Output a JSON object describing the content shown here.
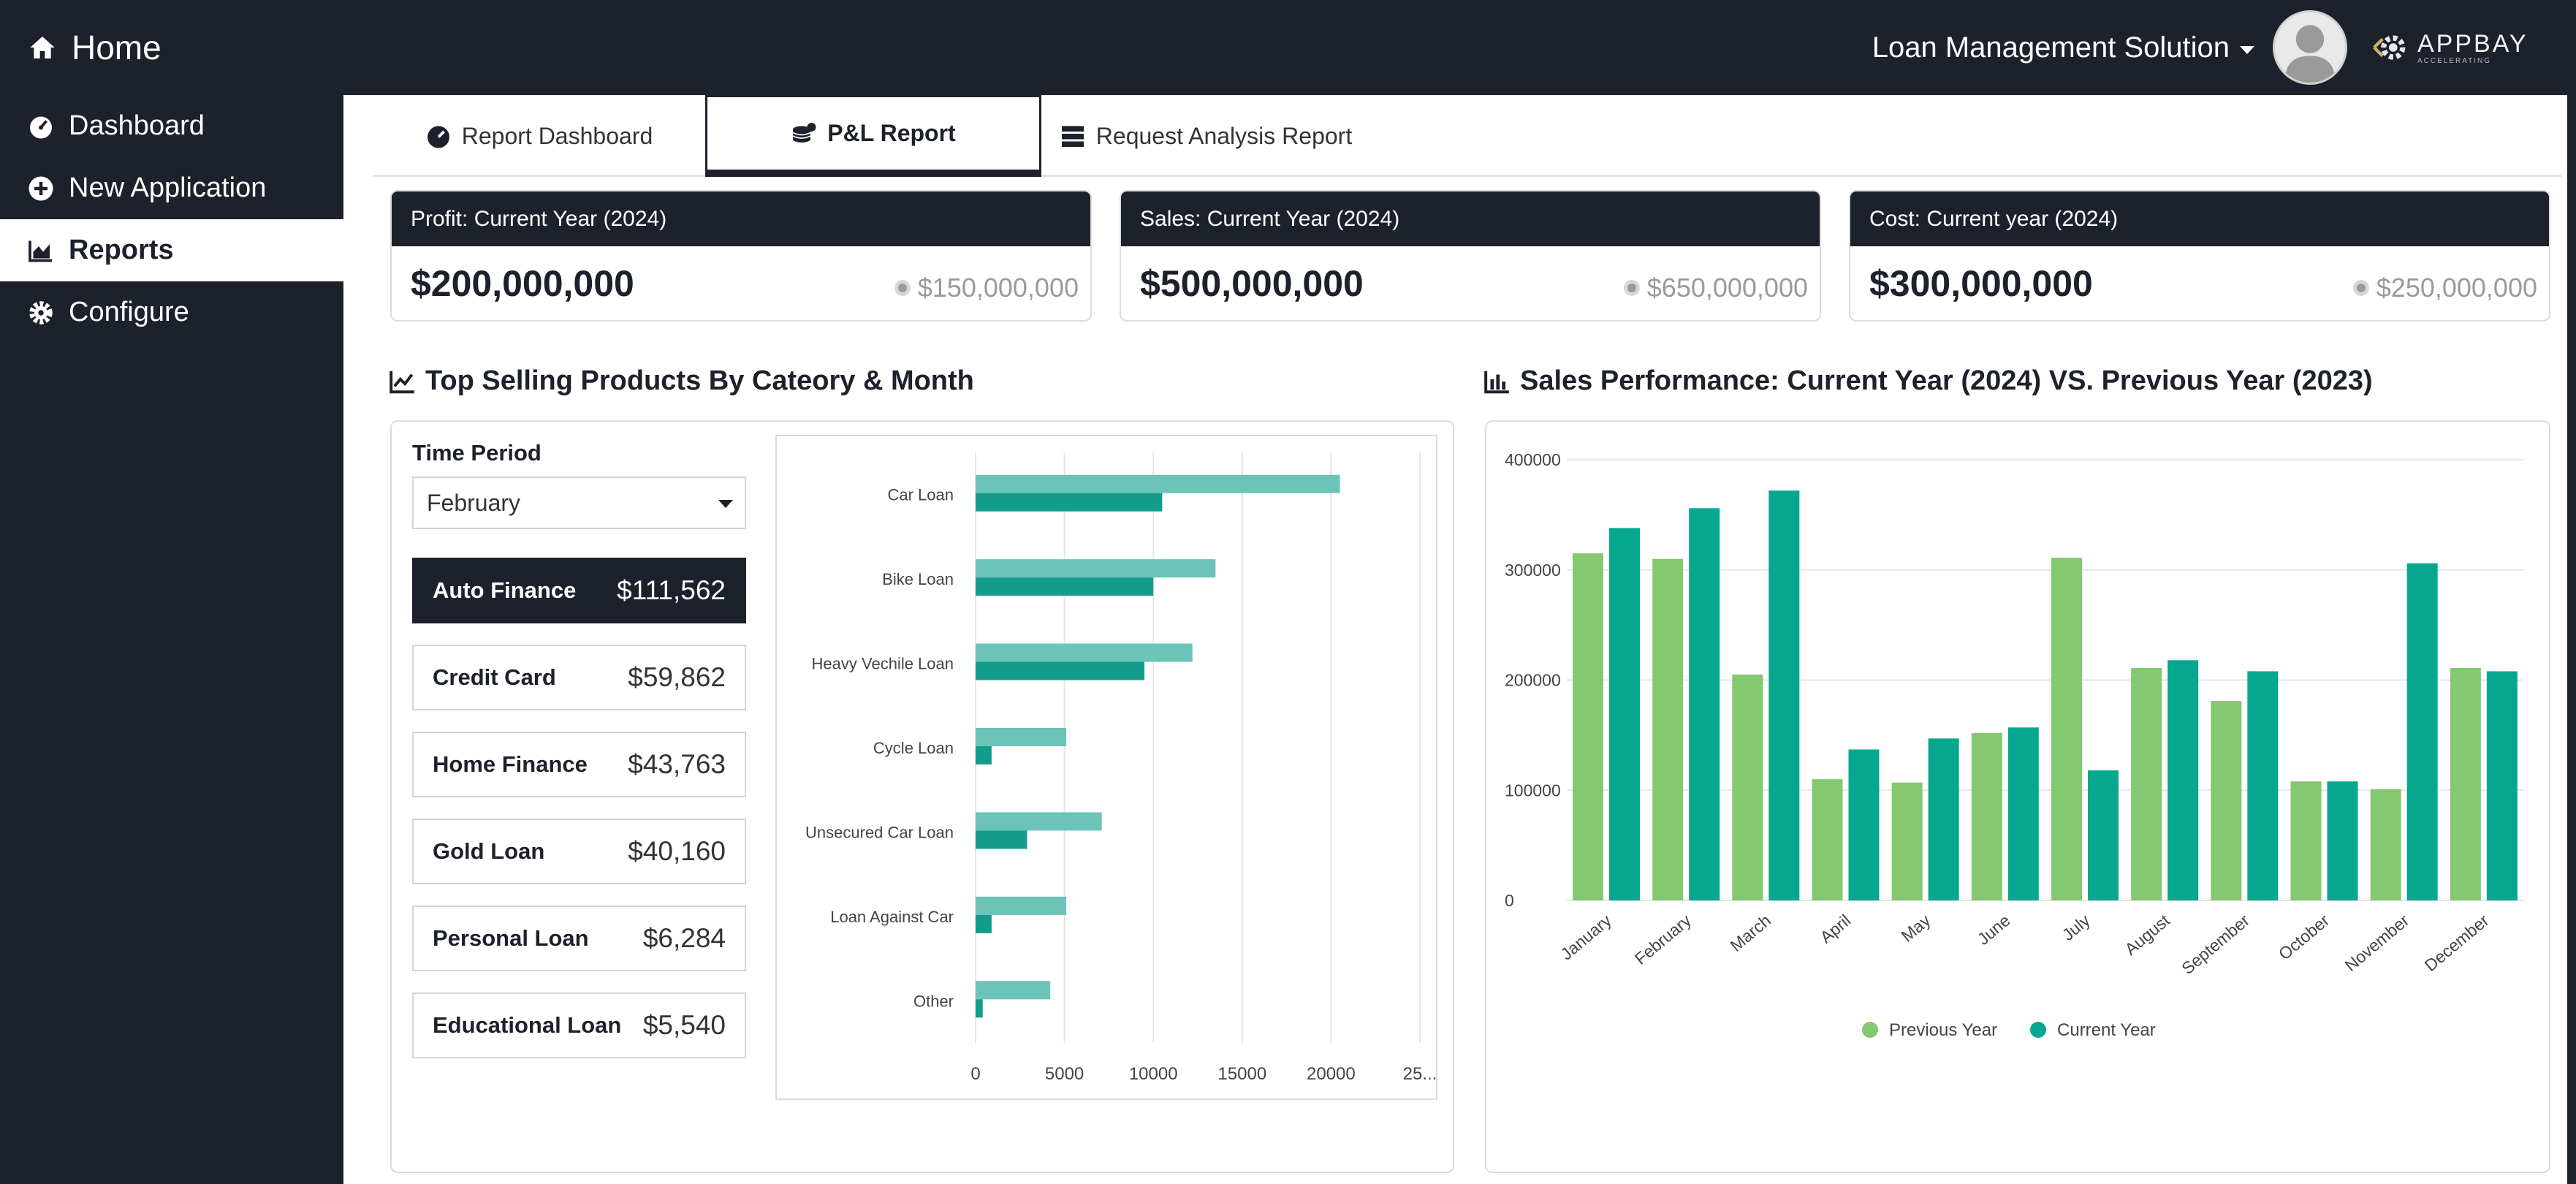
{
  "header": {
    "home_label": "Home",
    "solution_label": "Loan Management Solution",
    "logo_text": "APPBAY",
    "logo_tagline": "ACCELERATING"
  },
  "sidebar": {
    "items": [
      {
        "label": "Dashboard",
        "icon": "dashboard-gauge-icon"
      },
      {
        "label": "New Application",
        "icon": "plus-circle-icon"
      },
      {
        "label": "Reports",
        "icon": "area-chart-icon",
        "active": true
      },
      {
        "label": "Configure",
        "icon": "gear-icon"
      }
    ]
  },
  "tabs": [
    {
      "label": "Report Dashboard",
      "icon": "gauge-icon"
    },
    {
      "label": "P&L Report",
      "icon": "coins-icon",
      "active": true
    },
    {
      "label": "Request Analysis Report",
      "icon": "server-icon"
    }
  ],
  "kpis": [
    {
      "title": "Profit: Current Year (2024)",
      "value": "$200,000,000",
      "previous": "$150,000,000"
    },
    {
      "title": "Sales: Current Year (2024)",
      "value": "$500,000,000",
      "previous": "$650,000,000"
    },
    {
      "title": "Cost: Current year (2024)",
      "value": "$300,000,000",
      "previous": "$250,000,000"
    }
  ],
  "top_selling": {
    "title": "Top Selling Products By Cateory & Month",
    "time_period_label": "Time Period",
    "selected_month": "February",
    "products": [
      {
        "name": "Auto Finance",
        "value": "$111,562",
        "active": true
      },
      {
        "name": "Credit Card",
        "value": "$59,862"
      },
      {
        "name": "Home Finance",
        "value": "$43,763"
      },
      {
        "name": "Gold Loan",
        "value": "$40,160"
      },
      {
        "name": "Personal Loan",
        "value": "$6,284"
      },
      {
        "name": "Educational Loan",
        "value": "$5,540"
      }
    ]
  },
  "sales_performance": {
    "title": "Sales Performance: Current Year (2024) VS. Previous Year (2023)"
  },
  "colors": {
    "dark": "#1c212b",
    "bar_light": "#6cc3b8",
    "bar_dark": "#129c8c",
    "prev_year": "#84c870",
    "curr_year": "#05a88e"
  },
  "chart_data": [
    {
      "type": "bar",
      "orientation": "horizontal",
      "categories": [
        "Car Loan",
        "Bike Loan",
        "Heavy Vechile Loan",
        "Cycle Loan",
        "Unsecured Car Loan",
        "Loan Against Car",
        "Other"
      ],
      "series": [
        {
          "values": [
            20500,
            13500,
            12200,
            5100,
            7100,
            5100,
            4200
          ]
        },
        {
          "values": [
            10500,
            10000,
            9500,
            900,
            2900,
            900,
            400
          ]
        }
      ],
      "xlim": [
        0,
        25000
      ],
      "x_ticks": [
        "0",
        "5000",
        "10000",
        "15000",
        "20000",
        "25..."
      ],
      "grid": true,
      "legend": "none"
    },
    {
      "type": "bar",
      "categories": [
        "January",
        "February",
        "March",
        "April",
        "May",
        "June",
        "July",
        "August",
        "September",
        "October",
        "November",
        "December"
      ],
      "series": [
        {
          "name": "Previous Year",
          "values": [
            315000,
            310000,
            205000,
            110000,
            107000,
            152000,
            311000,
            211000,
            181000,
            108000,
            101000,
            211000
          ]
        },
        {
          "name": "Current Year",
          "values": [
            338000,
            356000,
            372000,
            137000,
            147000,
            157000,
            118000,
            218000,
            208000,
            108000,
            306000,
            208000
          ]
        }
      ],
      "ylim": [
        0,
        400000
      ],
      "y_ticks": [
        "0",
        "100000",
        "200000",
        "300000",
        "400000"
      ],
      "grid": true,
      "legend": "bottom"
    }
  ]
}
